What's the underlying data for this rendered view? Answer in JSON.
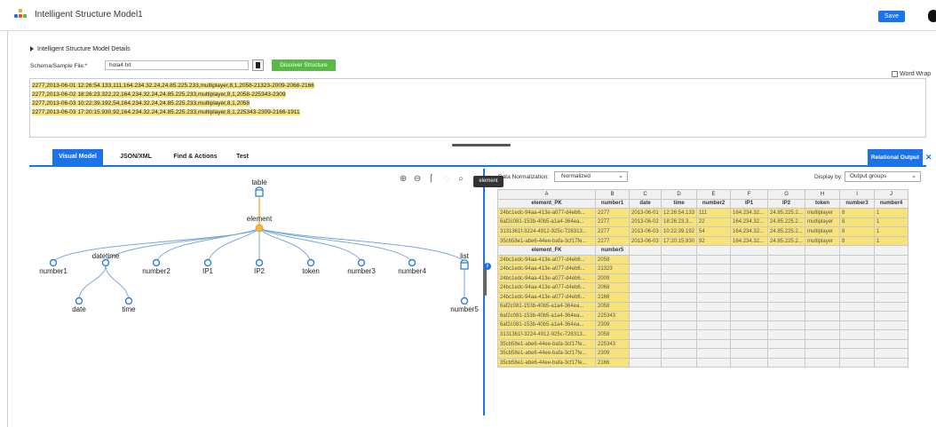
{
  "header": {
    "title": "Intelligent Structure Model1",
    "save_label": "Save",
    "logo_colors": [
      "#1a73e8",
      "#f5a623",
      "#e94e1b",
      "#58b947"
    ]
  },
  "details": {
    "toggle_label": "Intelligent Structure Model Details",
    "schema_label": "Schema/Sample File:*",
    "schema_value": "hola4.txt",
    "discover_label": "Discover Structure",
    "word_wrap_label": "Word Wrap"
  },
  "sample_lines": [
    "2277,2013-06-01 12:26:54.133,111,164.234.32.24,24.85.225.233,multiplayer,8,1,2058-21323-2009-2068-2166",
    "2277,2013-06-02 18:26:23.322,22,164.234.32.24,24.85.225.233,multiplayer,8,1,2058-225343-2309",
    "2277,2013-06-03 10:22:39.192,54,164.234.32.24,24.85.225.233,multiplayer,8,1,2058",
    "2277,2013-06-03 17:20:15.930,92,164.234.32.24,24.85.225.233,multiplayer,8,1,225343-2309-2166-1911"
  ],
  "tabs": [
    {
      "label": "Visual Model",
      "active": true
    },
    {
      "label": "JSON/XML",
      "active": false
    },
    {
      "label": "Find & Actions",
      "active": false
    },
    {
      "label": "Test",
      "active": false
    }
  ],
  "relational_output_label": "Relational Output",
  "tree": {
    "table": "table",
    "element": "element",
    "children": [
      "number1",
      "datetime",
      "number2",
      "IP1",
      "IP2",
      "token",
      "number3",
      "number4",
      "list"
    ],
    "datetime_children": [
      "date",
      "time"
    ],
    "list_children": [
      "number5"
    ]
  },
  "tooltip": "element",
  "relational": {
    "normalization_label": "Data Normalization:",
    "normalization_value": "Normalized",
    "display_label": "Display by:",
    "display_value": "Output groups",
    "column_letters": [
      "A",
      "B",
      "C",
      "D",
      "E",
      "F",
      "G",
      "H",
      "I",
      "J"
    ],
    "headers1": [
      "element_PK",
      "number1",
      "date",
      "time",
      "number2",
      "IP1",
      "IP2",
      "token",
      "number3",
      "number4"
    ],
    "rows1": [
      [
        "24bc1edc-94aa-413e-a077-d4eb6...",
        "2277",
        "2013-06-01",
        "12:26:54.133",
        "111",
        "164.234.32...",
        "24.85.225.2...",
        "multiplayer",
        "8",
        "1"
      ],
      [
        "6af2c081-153b-40b5-a1a4-364ea...",
        "2277",
        "2013-06-02",
        "18:26:23.3...",
        "22",
        "164.234.32...",
        "24.85.225.2...",
        "multiplayer",
        "8",
        "1"
      ],
      [
        "3131361f-3224-4912-925c-728313...",
        "2277",
        "2013-06-03",
        "10:22:39.192",
        "54",
        "164.234.32...",
        "24.85.225.2...",
        "multiplayer",
        "8",
        "1"
      ],
      [
        "35cb58e1-abe6-44ee-bafa-3cf17fe...",
        "2277",
        "2013-06-03",
        "17:20:15.930",
        "92",
        "164.234.32...",
        "24.85.225.2...",
        "multiplayer",
        "8",
        "1"
      ]
    ],
    "headers2": [
      "element_FK",
      "number5"
    ],
    "rows2": [
      [
        "24bc1edc-94aa-413e-a077-d4eb6...",
        "2058"
      ],
      [
        "24bc1edc-94aa-413e-a077-d4eb6...",
        "21323"
      ],
      [
        "24bc1edc-94aa-413e-a077-d4eb6...",
        "2009"
      ],
      [
        "24bc1edc-94aa-413e-a077-d4eb6...",
        "2068"
      ],
      [
        "24bc1edc-94aa-413e-a077-d4eb6...",
        "2166"
      ],
      [
        "6af2c081-153b-40b5-a1a4-364ea...",
        "2058"
      ],
      [
        "6af2c081-153b-40b5-a1a4-364ea...",
        "225343"
      ],
      [
        "6af2c081-153b-40b5-a1a4-364ea...",
        "2309"
      ],
      [
        "3131361f-3224-4912-925c-728313...",
        "2058"
      ],
      [
        "35cb58e1-abe6-44ee-bafa-3cf17fe...",
        "225343"
      ],
      [
        "35cb58e1-abe6-44ee-bafa-3cf17fe...",
        "2309"
      ],
      [
        "35cb58e1-abe6-44ee-bafa-3cf17fe...",
        "2166"
      ]
    ]
  },
  "colors": {
    "accent": "#1a73e8",
    "discover_green": "#58b947",
    "highlight_yellow": "#f7e37a",
    "node_blue": "#2f7fd6",
    "element_gold": "#f0b93a"
  },
  "toolbar_icons": [
    "zoom-in-icon",
    "zoom-out-icon",
    "fit-icon",
    "reset-icon",
    "search-icon"
  ]
}
